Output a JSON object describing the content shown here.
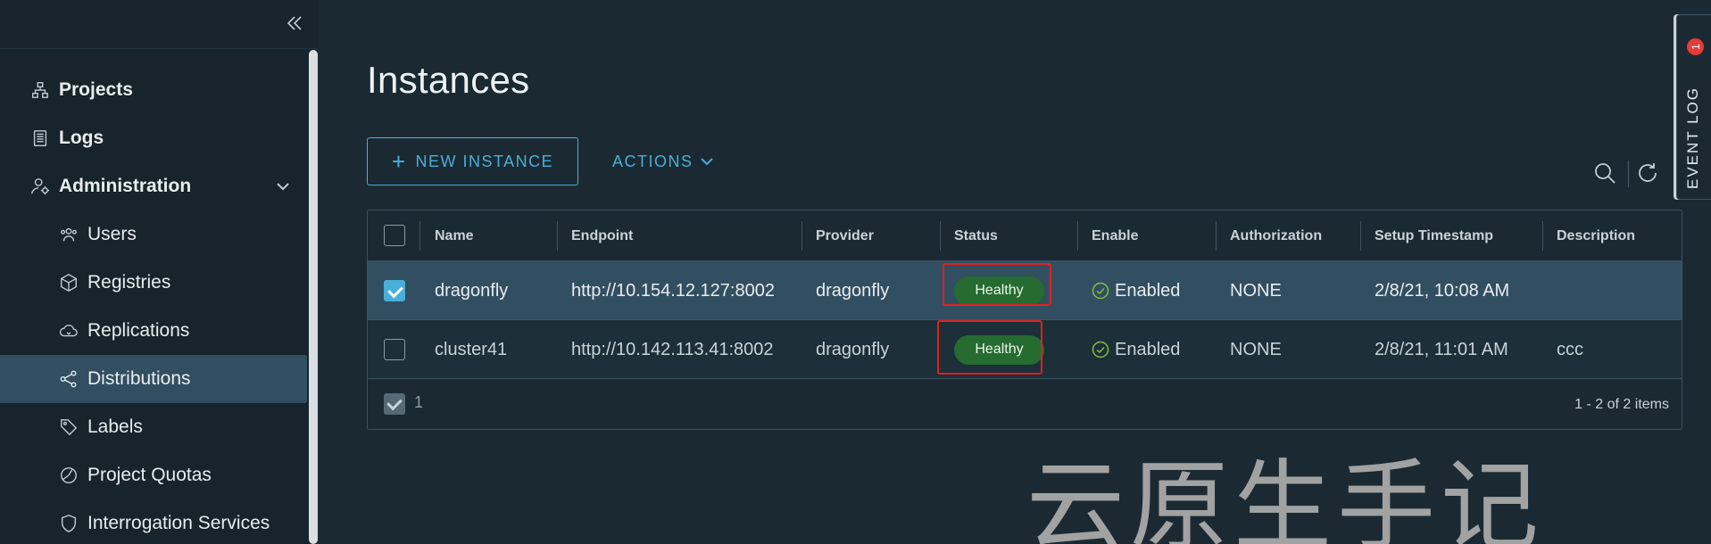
{
  "sidebar": {
    "items": [
      {
        "label": "Projects",
        "icon": "projects-icon"
      },
      {
        "label": "Logs",
        "icon": "logs-icon"
      },
      {
        "label": "Administration",
        "icon": "administration-icon"
      },
      {
        "label": "Users",
        "icon": "users-icon"
      },
      {
        "label": "Registries",
        "icon": "registries-icon"
      },
      {
        "label": "Replications",
        "icon": "replications-icon"
      },
      {
        "label": "Distributions",
        "icon": "distributions-icon",
        "active": true
      },
      {
        "label": "Labels",
        "icon": "labels-icon"
      },
      {
        "label": "Project Quotas",
        "icon": "project-quotas-icon"
      },
      {
        "label": "Interrogation Services",
        "icon": "interrogation-services-icon"
      }
    ]
  },
  "main": {
    "title": "Instances",
    "new_instance_plus": "+",
    "new_instance_label": "NEW INSTANCE",
    "actions_label": "ACTIONS"
  },
  "grid": {
    "columns": [
      "Name",
      "Endpoint",
      "Provider",
      "Status",
      "Enable",
      "Authorization",
      "Setup Timestamp",
      "Description"
    ],
    "rows": [
      {
        "selected": true,
        "name": "dragonfly",
        "endpoint": "http://10.154.12.127:8002",
        "provider": "dragonfly",
        "status": "Healthy",
        "enable": "Enabled",
        "authorization": "NONE",
        "timestamp": "2/8/21, 10:08 AM",
        "description": ""
      },
      {
        "selected": false,
        "name": "cluster41",
        "endpoint": "http://10.142.113.41:8002",
        "provider": "dragonfly",
        "status": "Healthy",
        "enable": "Enabled",
        "authorization": "NONE",
        "timestamp": "2/8/21, 11:01 AM",
        "description": "ccc"
      }
    ],
    "footer": {
      "selected_count": "1",
      "pagination": "1 - 2 of 2 items"
    }
  },
  "event_log": {
    "label": "EVENT LOG",
    "count": "1"
  },
  "watermark": "云原生手记",
  "colors": {
    "accent": "#49afd9",
    "healthy": "#266b2f",
    "highlight": "#e02020",
    "active_nav": "#324f61"
  }
}
